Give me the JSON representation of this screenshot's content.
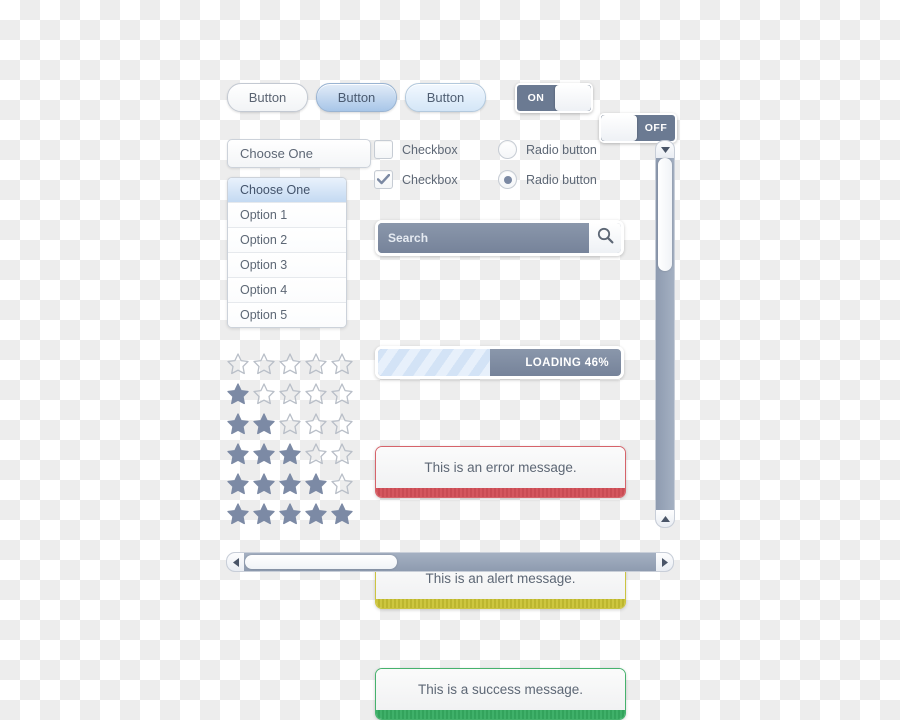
{
  "buttons": [
    {
      "label": "Button",
      "style": "white"
    },
    {
      "label": "Button",
      "style": "blue"
    },
    {
      "label": "Button",
      "style": "lightblue"
    }
  ],
  "toggles": [
    {
      "label": "ON",
      "state": "on"
    },
    {
      "label": "OFF",
      "state": "off"
    }
  ],
  "select": {
    "value": "Choose One",
    "options": [
      "Choose One",
      "Option 1",
      "Option 2",
      "Option 3",
      "Option 4",
      "Option 5"
    ],
    "selected_index": 0
  },
  "checkboxes": [
    {
      "label": "Checkbox",
      "checked": false
    },
    {
      "label": "Checkbox",
      "checked": true
    }
  ],
  "radios": [
    {
      "label": "Radio button",
      "checked": false
    },
    {
      "label": "Radio button",
      "checked": true
    }
  ],
  "search": {
    "placeholder": "Search",
    "value": "",
    "icon": "magnifier-icon"
  },
  "progress": {
    "label": "LOADING 46%",
    "percent": 46
  },
  "ratings": [
    {
      "filled": 0,
      "total": 5
    },
    {
      "filled": 1,
      "total": 5
    },
    {
      "filled": 2,
      "total": 5
    },
    {
      "filled": 3,
      "total": 5
    },
    {
      "filled": 4,
      "total": 5
    },
    {
      "filled": 5,
      "total": 5
    }
  ],
  "messages": [
    {
      "type": "error",
      "text": "This is an error message.",
      "color": "#d4565e"
    },
    {
      "type": "alert",
      "text": "This is an alert message.",
      "color": "#cdc63f"
    },
    {
      "type": "success",
      "text": "This is a success message.",
      "color": "#3fb069"
    }
  ],
  "scrollbars": {
    "vertical": {
      "top_arrow": "chevron-down-icon",
      "bottom_arrow": "chevron-up-icon",
      "thumb_percent": 32
    },
    "horizontal": {
      "left_arrow": "chevron-left-icon",
      "right_arrow": "chevron-right-icon",
      "thumb_percent": 37
    }
  },
  "colors": {
    "slate": "#7a879c",
    "accent_blue": "#a8c6e8",
    "text": "#5d6775",
    "error": "#d4565e",
    "alert": "#cdc63f",
    "success": "#3fb069"
  }
}
